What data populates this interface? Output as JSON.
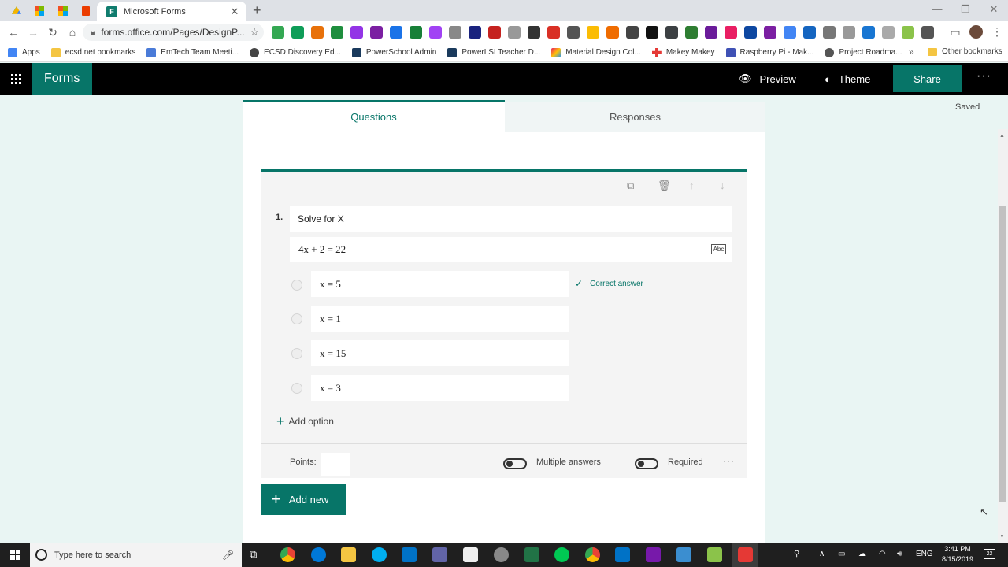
{
  "browser": {
    "tab_title": "Microsoft Forms",
    "tab_favicon": "F",
    "new_tab": "+",
    "close_tab": "✕",
    "url": "forms.office.com/Pages/DesignP...",
    "window": {
      "minimize": "—",
      "maximize": "❐",
      "close": "✕"
    }
  },
  "bookmarks": [
    {
      "label": "Apps",
      "color": "#4285f4"
    },
    {
      "label": "ecsd.net bookmarks",
      "color": "#f4c542"
    },
    {
      "label": "EmTech Team Meeti...",
      "color": "#4a7bd8"
    },
    {
      "label": "ECSD Discovery Ed...",
      "color": "#444444"
    },
    {
      "label": "PowerSchool Admin",
      "color": "#1a3a5c"
    },
    {
      "label": "PowerLSI Teacher D...",
      "color": "#1a3a5c"
    },
    {
      "label": "Material Design Col...",
      "color": "#e91e63"
    },
    {
      "label": "Makey Makey",
      "color": "#e53935"
    },
    {
      "label": "Raspberry Pi - Mak...",
      "color": "#3f51b5"
    },
    {
      "label": "Project Roadma...",
      "color": "#555555"
    }
  ],
  "bookmarks_more": "»",
  "bookmarks_other": "Other bookmarks",
  "app": {
    "name": "Forms",
    "preview": "Preview",
    "theme": "Theme",
    "share": "Share",
    "more": "···",
    "saved": "Saved"
  },
  "tabs": {
    "questions": "Questions",
    "responses": "Responses"
  },
  "question": {
    "number": "1.",
    "title": "Solve for X",
    "subtitle": "4x + 2 = 22",
    "abc": "Abc",
    "options": [
      "x = 5",
      "x = 1",
      "x = 15",
      "x = 3"
    ],
    "correct_label": "Correct answer",
    "add_option": "Add option",
    "points_label": "Points:",
    "multiple_answers": "Multiple answers",
    "required": "Required",
    "more": "···"
  },
  "add_new": "Add new",
  "taskbar": {
    "search_placeholder": "Type here to search",
    "lang": "ENG",
    "time": "3:41 PM",
    "date": "8/15/2019",
    "notifications": "22"
  },
  "colors": {
    "brand": "#077568",
    "appbar": "#000000",
    "page_bg": "#e9f5f3"
  }
}
